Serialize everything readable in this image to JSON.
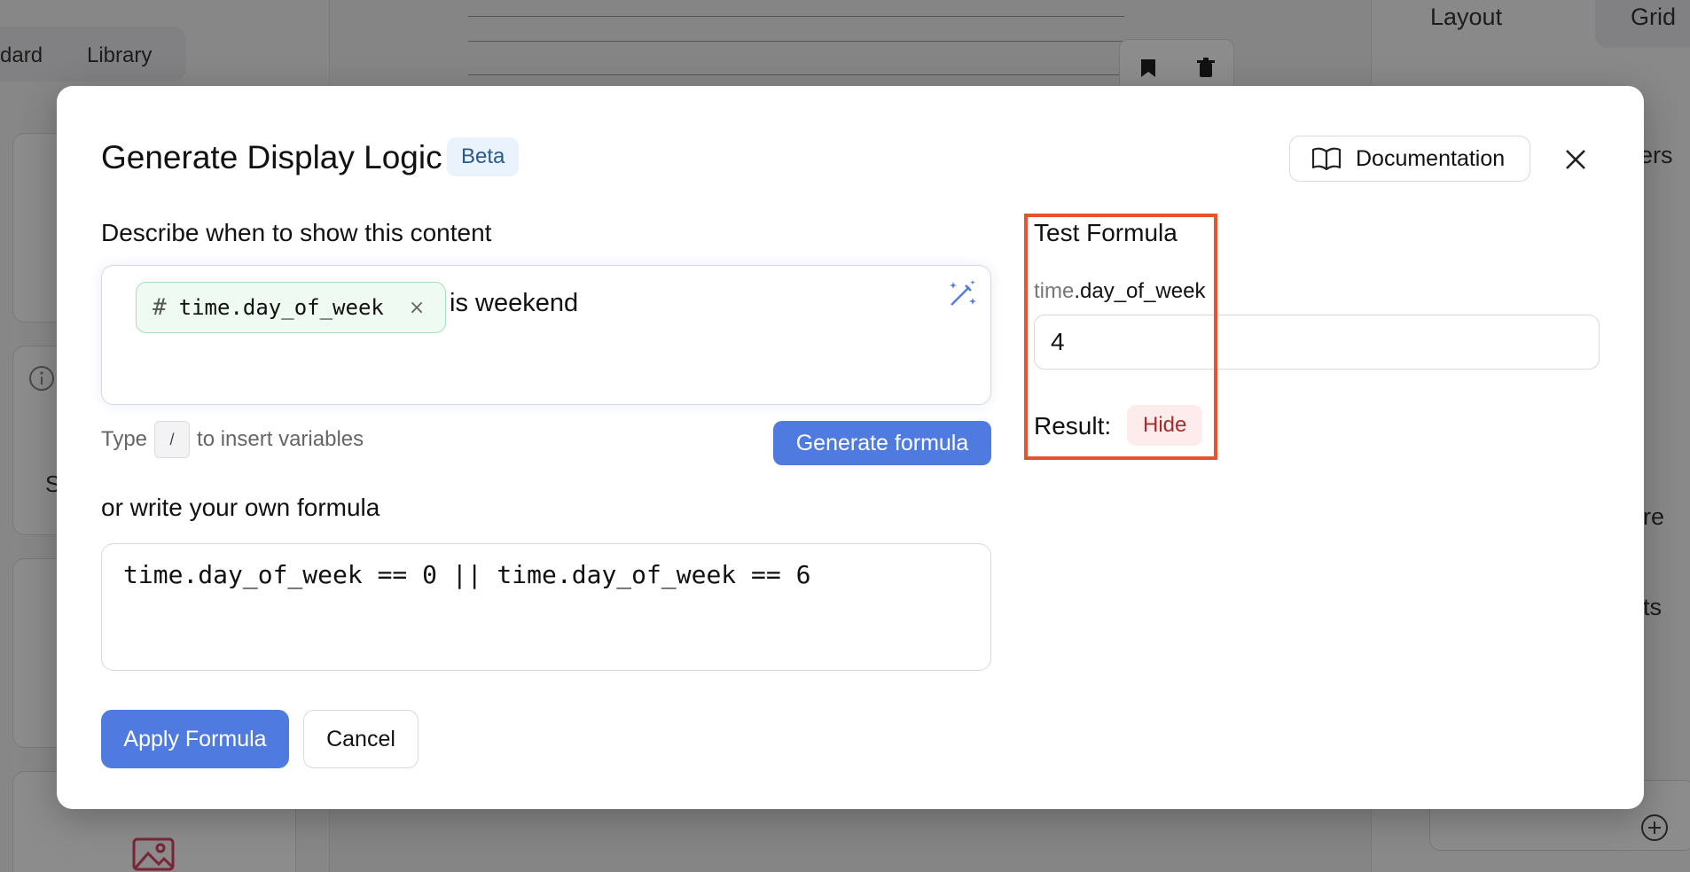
{
  "background": {
    "tabs": [
      "dard",
      "Library"
    ],
    "right_tabs": [
      "Layout",
      "Grid"
    ],
    "right_fragments": [
      "lers",
      "re",
      "ts"
    ],
    "left_fragment": "S"
  },
  "modal": {
    "title": "Generate Display Logic",
    "badge": "Beta",
    "doc_button": "Documentation",
    "describe_label": "Describe when to show this content",
    "chip_symbol": "#",
    "chip_variable": "time.day_of_week",
    "chip_remove": "×",
    "describe_text": "is weekend",
    "hint_before": "Type",
    "hint_key": "/",
    "hint_after": "to insert variables",
    "generate_button": "Generate formula",
    "own_formula_label": "or write your own formula",
    "formula": "time.day_of_week == 0 || time.day_of_week == 6",
    "apply_button": "Apply Formula",
    "cancel_button": "Cancel"
  },
  "test": {
    "title": "Test Formula",
    "var_prefix": "time",
    "var_suffix": ".day_of_week",
    "input_value": "4",
    "result_label": "Result:",
    "result_value": "Hide"
  },
  "colors": {
    "primary": "#4f7be0",
    "highlight": "#e8532b",
    "chip_bg": "#effaf2",
    "hide_badge_bg": "#fdeceb",
    "hide_badge_text": "#a32d2d"
  },
  "icons": [
    "book-open-icon",
    "close-icon",
    "magic-wand-icon",
    "bookmark-icon",
    "trash-icon",
    "image-icon",
    "info-icon",
    "plus-circle-icon"
  ]
}
